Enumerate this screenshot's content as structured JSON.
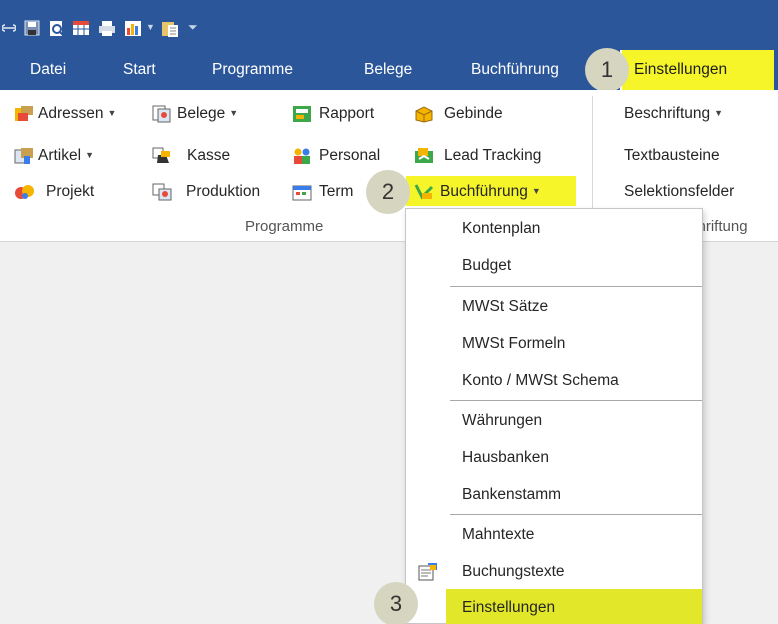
{
  "quick_access": {
    "icons": [
      "link-icon",
      "save-icon",
      "print-preview-icon",
      "table-icon",
      "printer-icon",
      "chart-icon",
      "paste-icon",
      "customize-arrow-icon"
    ]
  },
  "tabs": [
    "Datei",
    "Start",
    "Programme",
    "Belege",
    "Buchführung",
    "Einstellungen"
  ],
  "active_tab": "Einstellungen",
  "ribbon": {
    "buttons": {
      "adressen": "Adressen",
      "belege": "Belege",
      "rapport": "Rapport",
      "gebinde": "Gebinde",
      "artikel": "Artikel",
      "kasse": "Kasse",
      "personal": "Personal",
      "lead_tracking": "Lead Tracking",
      "projekt": "Projekt",
      "produktion": "Produktion",
      "termine": "Term",
      "buchfuehrung": "Buchführung"
    },
    "right_group": {
      "beschriftung": "Beschriftung",
      "textbausteine": "Textbausteine",
      "selektionsfelder": "Selektionsfelder"
    },
    "group_label": "Programme",
    "group_label_2": "chriftung"
  },
  "callouts": [
    "1",
    "2",
    "3"
  ],
  "menu": {
    "items": [
      "Kontenplan",
      "Budget",
      "MWSt Sätze",
      "MWSt Formeln",
      "Konto / MWSt Schema",
      "Währungen",
      "Hausbanken",
      "Bankenstamm",
      "Mahntexte",
      "Buchungstexte",
      "Einstellungen"
    ],
    "highlighted": "Einstellungen"
  },
  "colors": {
    "title_bar": "#2b579a",
    "highlight": "#f5f52a",
    "callout": "#d6d6c0"
  }
}
